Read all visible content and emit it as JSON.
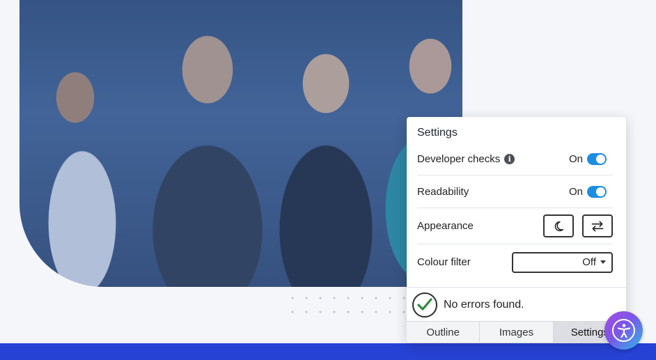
{
  "settings": {
    "title": "Settings",
    "developer_checks": {
      "label": "Developer checks",
      "state": "On"
    },
    "readability": {
      "label": "Readability",
      "state": "On"
    },
    "appearance": {
      "label": "Appearance"
    },
    "colour_filter": {
      "label": "Colour filter",
      "value": "Off"
    }
  },
  "status": {
    "message": "No errors found."
  },
  "tabs": [
    {
      "label": "Outline"
    },
    {
      "label": "Images"
    },
    {
      "label": "Settings",
      "active": true
    }
  ],
  "colors": {
    "toggle_on": "#1c8de0",
    "footer_bar": "#2642d4",
    "check_green": "#2e8b3a"
  },
  "icons": [
    "info-icon",
    "moon-icon",
    "swap-arrows-icon",
    "checkmark-icon",
    "chevron-down-icon",
    "accessibility-icon"
  ]
}
